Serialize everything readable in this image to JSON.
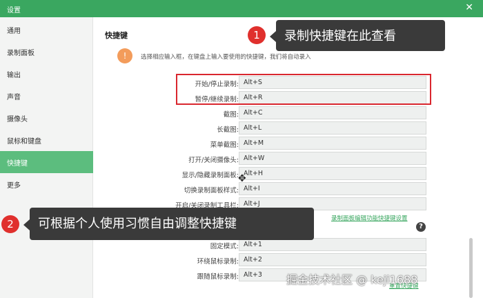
{
  "window": {
    "title": "设置",
    "close_glyph": "✕"
  },
  "sidebar": {
    "items": [
      {
        "label": "通用",
        "active": false
      },
      {
        "label": "录制面板",
        "active": false
      },
      {
        "label": "输出",
        "active": false
      },
      {
        "label": "声音",
        "active": false
      },
      {
        "label": "摄像头",
        "active": false
      },
      {
        "label": "鼠标和键盘",
        "active": false
      },
      {
        "label": "快捷键",
        "active": true
      },
      {
        "label": "更多",
        "active": false
      }
    ]
  },
  "main": {
    "section_title": "快捷键",
    "hint": "选择相应输入框，在键盘上输入要使用的快捷键，我们将自动录入",
    "hint_icon": "!",
    "shortcuts": [
      {
        "label": "开始/停止录制:",
        "value": "Alt+S"
      },
      {
        "label": "暂停/继续录制:",
        "value": "Alt+R"
      },
      {
        "label": "截图:",
        "value": "Alt+C"
      },
      {
        "label": "长截图:",
        "value": "Alt+L"
      },
      {
        "label": "菜单截图:",
        "value": "Alt+M"
      },
      {
        "label": "打开/关闭摄像头:",
        "value": "Alt+W"
      },
      {
        "label": "显示/隐藏录制面板:",
        "value": "Alt+H"
      },
      {
        "label": "切换录制面板样式:",
        "value": "Alt+I"
      },
      {
        "label": "开启/关闭录制工具栏:",
        "value": "Alt+J"
      }
    ],
    "panel_link": "录制面板编辑功能快捷键设置",
    "help_icon": "?",
    "lower_shortcuts": [
      {
        "label": "固定模式:",
        "value": "Alt+1"
      },
      {
        "label": "环绕鼠标录制:",
        "value": "Alt+2"
      },
      {
        "label": "跟随鼠标录制:",
        "value": "Alt+3"
      }
    ],
    "reset_link": "重置快捷键"
  },
  "annotations": [
    {
      "number": "1",
      "text": "录制快捷键在此查看"
    },
    {
      "number": "2",
      "text": "可根据个人使用习惯自由调整快捷键"
    }
  ],
  "watermark": "掘金技术社区 @ keji1688",
  "colors": {
    "accent": "#3aa760",
    "active_item": "#5cbd7e",
    "highlight_border": "#d9262e"
  }
}
